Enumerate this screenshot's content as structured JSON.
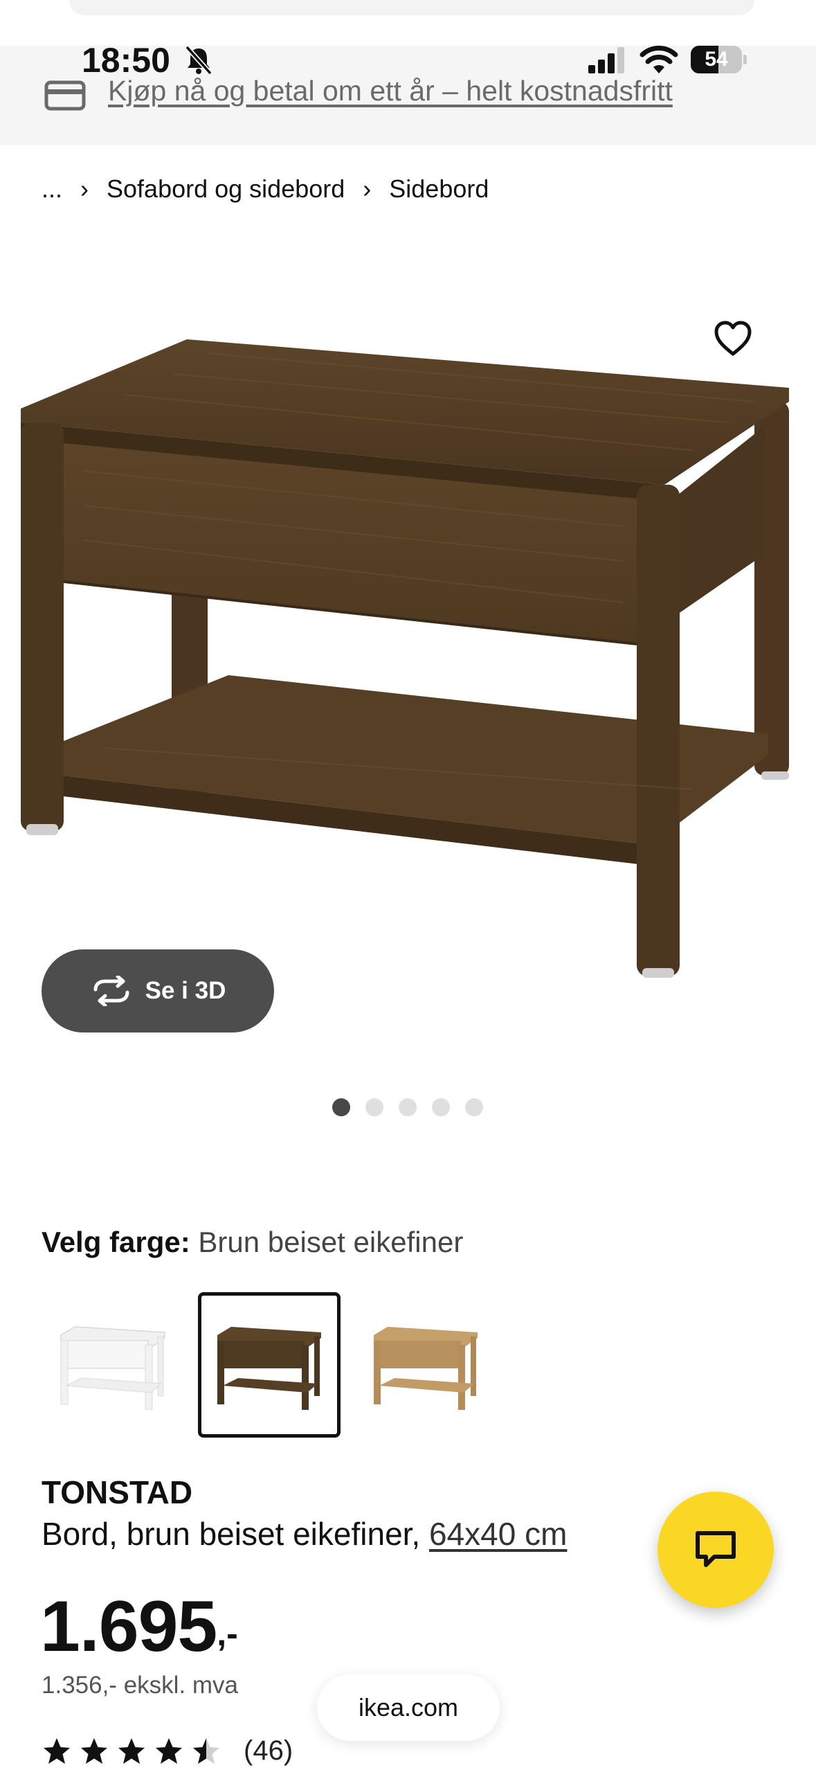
{
  "status_bar": {
    "time": "18:50",
    "battery": "54",
    "icons": [
      "bell-muted-icon",
      "signal-icon",
      "wifi-icon",
      "battery-icon"
    ]
  },
  "promo": {
    "icon": "credit-card-icon",
    "text": "Kjøp nå og betal om ett år – helt kostnadsfritt"
  },
  "breadcrumb": {
    "items": [
      "...",
      "Sofabord og sidebord",
      "Sidebord"
    ],
    "separator": "›"
  },
  "gallery": {
    "favorite_icon": "heart-icon",
    "view_3d_label": "Se i 3D",
    "view_3d_icon": "rotate-icon",
    "slide_count": 5,
    "active_slide": 1
  },
  "color": {
    "label": "Velg farge:",
    "value": "Brun beiset eikefiner",
    "swatches": [
      "white",
      "brown-stained-oak",
      "oak"
    ],
    "selected_index": 1
  },
  "product": {
    "name": "TONSTAD",
    "description": "Bord, brun beiset eikefiner,",
    "dimensions": "64x40 cm",
    "price": "1.695",
    "price_suffix": ",-",
    "price_ex_vat": "1.356,- ekskl. mva",
    "rating_value": 4.5,
    "review_count": "(46)"
  },
  "footer": {
    "domain": "ikea.com",
    "chat_icon": "chat-icon"
  },
  "colors": {
    "chat_button": "#fad724",
    "wood_dark": "#5a4226",
    "btn_3d": "#4d4d4d"
  }
}
